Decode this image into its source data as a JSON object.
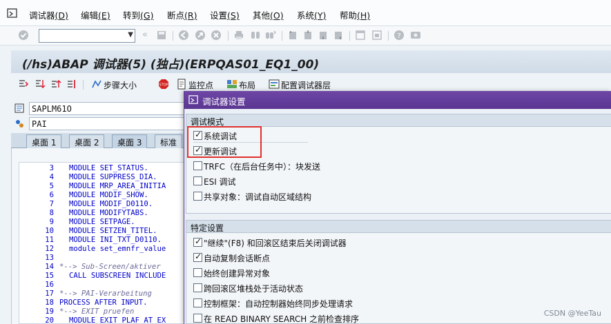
{
  "menubar": {
    "items": [
      {
        "label": "调试器",
        "key": "(D)"
      },
      {
        "label": "编辑",
        "key": "(E)"
      },
      {
        "label": "转到",
        "key": "(G)"
      },
      {
        "label": "断点",
        "key": "(R)"
      },
      {
        "label": "设置",
        "key": "(S)"
      },
      {
        "label": "其他",
        "key": "(O)"
      },
      {
        "label": "系统",
        "key": "(Y)"
      },
      {
        "label": "帮助",
        "key": "(H)"
      }
    ]
  },
  "toolbar": {
    "command_value": ""
  },
  "title": "(/hs)ABAP 调试器(5)   (独占)(ERPQAS01_EQ1_00)",
  "app_toolbar": {
    "step_size": "步骤大小",
    "watchpoint": "监控点",
    "layout": "布局",
    "configure_layers": "配置调试器层"
  },
  "fields": {
    "program": "SAPLM61O",
    "include": "PAI"
  },
  "tabs": [
    "桌面 1",
    "桌面 2",
    "桌面 3",
    "标准"
  ],
  "code_lines": [
    {
      "ln": "3",
      "text": "MODULE SET_STATUS.",
      "comment": false,
      "indent": 1
    },
    {
      "ln": "4",
      "text": "MODULE SUPPRESS_DIA.",
      "comment": false,
      "indent": 1
    },
    {
      "ln": "5",
      "text": "MODULE MRP_AREA_INITIA",
      "comment": false,
      "indent": 1
    },
    {
      "ln": "6",
      "text": "MODULE MODIF_SHOW.",
      "comment": false,
      "indent": 1
    },
    {
      "ln": "7",
      "text": "MODULE MODIF_D0110.",
      "comment": false,
      "indent": 1
    },
    {
      "ln": "8",
      "text": "MODULE MODIFYTABS.",
      "comment": false,
      "indent": 1
    },
    {
      "ln": "9",
      "text": "MODULE SETPAGE.",
      "comment": false,
      "indent": 1
    },
    {
      "ln": "10",
      "text": "MODULE SETZEN_TITEL.",
      "comment": false,
      "indent": 1
    },
    {
      "ln": "11",
      "text": "MODULE INI_TXT_D0110.",
      "comment": false,
      "indent": 1
    },
    {
      "ln": "12",
      "text": "module set_emnfr_value",
      "comment": false,
      "indent": 1
    },
    {
      "ln": "13",
      "text": "",
      "comment": false,
      "indent": 0
    },
    {
      "ln": "14",
      "text": "*--> Sub-Screen/aktiver",
      "comment": true,
      "indent": 0
    },
    {
      "ln": "15",
      "text": "CALL SUBSCREEN INCLUDE",
      "comment": false,
      "indent": 1
    },
    {
      "ln": "16",
      "text": "",
      "comment": false,
      "indent": 0
    },
    {
      "ln": "17",
      "text": "*--> PAI-Verarbeitung",
      "comment": true,
      "indent": 0
    },
    {
      "ln": "18",
      "text": "PROCESS AFTER INPUT.",
      "comment": false,
      "indent": 0
    },
    {
      "ln": "19",
      "text": "*--> EXIT pruefen",
      "comment": true,
      "indent": 0
    },
    {
      "ln": "20",
      "text": "MODULE EXIT_PLAF AT EX",
      "comment": false,
      "indent": 1
    }
  ],
  "dialog": {
    "title": "调试器设置",
    "group1": {
      "title": "调试模式",
      "options": [
        {
          "label": "系统调试",
          "checked": true
        },
        {
          "label": "更新调试",
          "checked": true
        },
        {
          "label": "TRFC（在后台任务中）：块发送",
          "checked": false
        },
        {
          "label": "ESI 调试",
          "checked": false
        },
        {
          "label": "共享对象：调试自动区域结构",
          "checked": false
        }
      ]
    },
    "group2": {
      "title": "特定设置",
      "options": [
        {
          "label": "\"继续\"(F8) 和回滚区结束后关闭调试器",
          "checked": true
        },
        {
          "label": "自动复制会话断点",
          "checked": true
        },
        {
          "label": "始终创建异常对象",
          "checked": false
        },
        {
          "label": "跨回滚区堆栈处于活动状态",
          "checked": false
        },
        {
          "label": "控制框架：自动控制器始终同步处理请求",
          "checked": false
        },
        {
          "label": "在 READ BINARY SEARCH 之前检查排序",
          "checked": false
        }
      ]
    }
  },
  "watermark": "CSDN @YeeTau",
  "colors": {
    "dialog_title": "#5a3591",
    "highlight": "#e0302c",
    "code_blue": "#0000c8"
  }
}
